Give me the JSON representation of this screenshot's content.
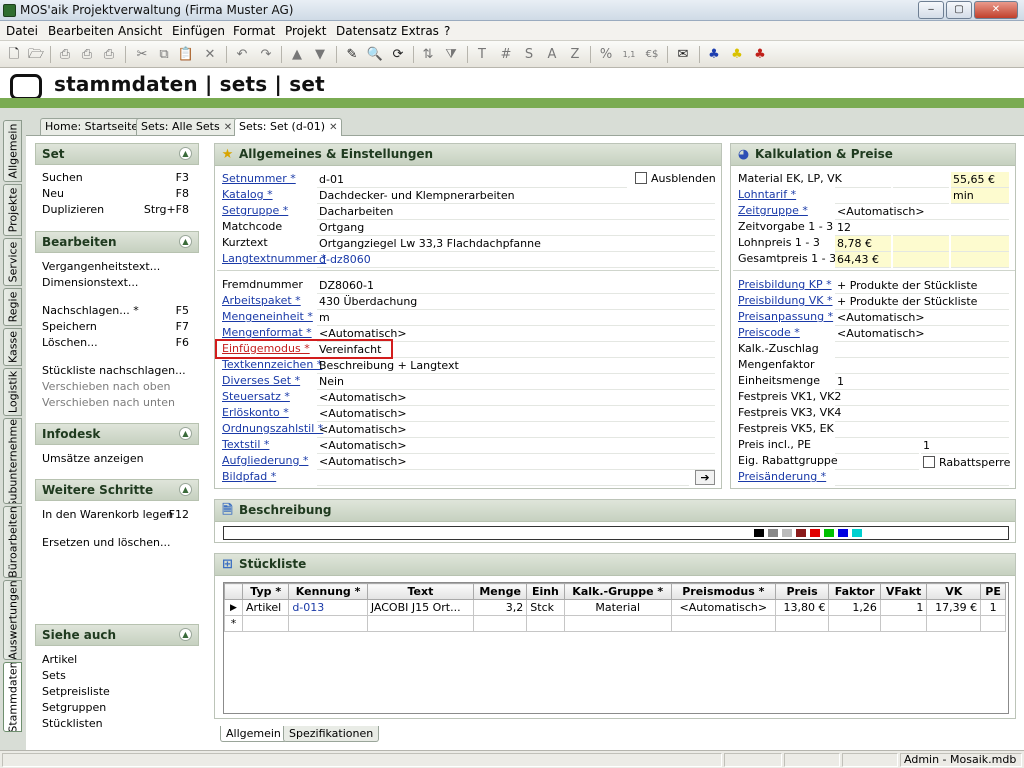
{
  "window": {
    "title": "MOS'aik Projektverwaltung (Firma Muster AG)",
    "min": "‒",
    "max": "▢",
    "close": "✕"
  },
  "menu": [
    "Datei",
    "Bearbeiten",
    "Ansicht",
    "Einfügen",
    "Format",
    "Projekt",
    "Datensatz",
    "Extras",
    "?"
  ],
  "toolbar_text": {
    "t": "T",
    "hash": "#",
    "s": "S",
    "a": "A",
    "z": "Z",
    "pct": "%",
    "num": "1,1",
    "eur": "€$"
  },
  "header": {
    "title": "stammdaten | sets | set"
  },
  "vtabs": [
    "Allgemein",
    "Projekte",
    "Service",
    "Regie",
    "Kasse",
    "Logistik",
    "Subunternehmer",
    "Büroarbeiten",
    "Auswertungen",
    "Stammdaten"
  ],
  "doctabs": [
    {
      "label": "Home: Startseite"
    },
    {
      "label": "Sets: Alle Sets",
      "close": "✕"
    },
    {
      "label": "Sets: Set (d-01)",
      "close": "✕"
    }
  ],
  "left": {
    "set": {
      "title": "Set",
      "items": [
        {
          "label": "Suchen",
          "key": "F3"
        },
        {
          "label": "Neu",
          "key": "F8"
        },
        {
          "label": "Duplizieren",
          "key": "Strg+F8"
        }
      ]
    },
    "bearbeiten": {
      "title": "Bearbeiten",
      "items": [
        {
          "label": "Vergangenheitstext..."
        },
        {
          "label": "Dimensionstext..."
        },
        {
          "label": "Nachschlagen... *",
          "key": "F5"
        },
        {
          "label": "Speichern",
          "key": "F7"
        },
        {
          "label": "Löschen...",
          "key": "F6"
        },
        {
          "label": "Stückliste nachschlagen..."
        },
        {
          "label": "Verschieben nach oben"
        },
        {
          "label": "Verschieben nach unten"
        }
      ]
    },
    "infodesk": {
      "title": "Infodesk",
      "items": [
        {
          "label": "Umsätze anzeigen"
        }
      ]
    },
    "weitere": {
      "title": "Weitere Schritte",
      "items": [
        {
          "label": "In den Warenkorb legen",
          "key": "F12"
        },
        {
          "label": "Ersetzen und löschen..."
        }
      ]
    },
    "siehe": {
      "title": "Siehe auch",
      "items": [
        {
          "label": "Artikel"
        },
        {
          "label": "Sets"
        },
        {
          "label": "Setpreisliste"
        },
        {
          "label": "Setgruppen"
        },
        {
          "label": "Stücklisten"
        }
      ]
    }
  },
  "allgemeines": {
    "title": "Allgemeines & Einstellungen",
    "ausblenden": "Ausblenden",
    "rows1": [
      {
        "label": "Setnummer *",
        "value": "d-01",
        "link": true
      },
      {
        "label": "Katalog *",
        "value": "Dachdecker- und Klempnerarbeiten",
        "link": true
      },
      {
        "label": "Setgruppe *",
        "value": "Dacharbeiten",
        "link": true
      },
      {
        "label": "Matchcode",
        "value": "Ortgang",
        "link": false
      },
      {
        "label": "Kurztext",
        "value": "Ortgangziegel Lw 33,3 Flachdachpfanne",
        "link": false
      },
      {
        "label": "Langtextnummer *",
        "value": "d-dz8060",
        "link": true,
        "bluevalue": true
      }
    ],
    "rows2": [
      {
        "label": "Fremdnummer",
        "value": "DZ8060-1",
        "link": false
      },
      {
        "label": "Arbeitspaket *",
        "value": "430 Überdachung",
        "link": true
      },
      {
        "label": "Mengeneinheit *",
        "value": "m",
        "link": true
      },
      {
        "label": "Mengenformat *",
        "value": "<Automatisch>",
        "link": true
      },
      {
        "label": "Einfügemodus *",
        "value": "Vereinfacht",
        "link": true,
        "highlight": true
      },
      {
        "label": "Textkennzeichen *",
        "value": "Beschreibung + Langtext",
        "link": true
      },
      {
        "label": "Diverses Set *",
        "value": "Nein",
        "link": true
      },
      {
        "label": "Steuersatz *",
        "value": "<Automatisch>",
        "link": true
      },
      {
        "label": "Erlöskonto *",
        "value": "<Automatisch>",
        "link": true
      },
      {
        "label": "Ordnungszahlstil *",
        "value": "<Automatisch>",
        "link": true
      },
      {
        "label": "Textstil *",
        "value": "<Automatisch>",
        "link": true
      },
      {
        "label": "Aufgliederung *",
        "value": "<Automatisch>",
        "link": true
      },
      {
        "label": "Bildpfad *",
        "value": "",
        "link": true
      }
    ]
  },
  "kalkulation": {
    "title": "Kalkulation & Preise",
    "rows1": [
      {
        "label": "Material EK, LP, VK",
        "v1": "",
        "v2": "",
        "v3": "55,65 €",
        "link": false
      },
      {
        "label": "Lohntarif *",
        "v1": "",
        "v2": "",
        "v3": "min",
        "link": true
      },
      {
        "label": "Zeitgruppe *",
        "v1": "<Automatisch>",
        "link": true,
        "wide": true
      },
      {
        "label": "Zeitvorgabe 1 - 3",
        "v1": "12",
        "v2": "",
        "v3": "",
        "link": false
      },
      {
        "label": "Lohnpreis 1 - 3",
        "v1": "8,78 €",
        "v2": "",
        "v3": "",
        "link": false,
        "yellowall": true
      },
      {
        "label": "Gesamtpreis 1 - 3",
        "v1": "64,43 €",
        "v2": "",
        "v3": "",
        "link": false,
        "yellowall": true
      }
    ],
    "rows2": [
      {
        "label": "Preisbildung KP *",
        "value": "+ Produkte der Stückliste",
        "link": true
      },
      {
        "label": "Preisbildung VK *",
        "value": "+ Produkte der Stückliste",
        "link": true
      },
      {
        "label": "Preisanpassung *",
        "value": "<Automatisch>",
        "link": true
      },
      {
        "label": "Preiscode *",
        "value": "<Automatisch>",
        "link": true
      },
      {
        "label": "Kalk.-Zuschlag",
        "value": "",
        "link": false
      },
      {
        "label": "Mengenfaktor",
        "value": "",
        "link": false
      },
      {
        "label": "Einheitsmenge",
        "value": "1",
        "link": false
      },
      {
        "label": "Festpreis VK1, VK2",
        "value": "",
        "link": false
      },
      {
        "label": "Festpreis VK3, VK4",
        "value": "",
        "link": false
      },
      {
        "label": "Festpreis VK5, EK",
        "value": "",
        "link": false
      },
      {
        "label": "Preis incl., PE",
        "value": "",
        "value2": "1",
        "link": false
      },
      {
        "label": "Eig. Rabattgruppe",
        "value": "",
        "link": false
      },
      {
        "label": "Preisänderung *",
        "value": "",
        "link": true
      }
    ],
    "rabattsperre": "Rabattsperre"
  },
  "beschreibung": {
    "title": "Beschreibung"
  },
  "stueckliste": {
    "title": "Stückliste",
    "columns": [
      "",
      "Typ *",
      "Kennung *",
      "Text",
      "Menge",
      "Einh",
      "Kalk.-Gruppe *",
      "Preismodus *",
      "Preis",
      "Faktor",
      "VFakt",
      "VK",
      "PE"
    ],
    "rows": [
      {
        "marker": "▶",
        "typ": "Artikel",
        "kennung": "d-013",
        "text": "JACOBI J15 Ort...",
        "menge": "3,2",
        "einh": "Stck",
        "kalk": "Material",
        "preismodus": "<Automatisch>",
        "preis": "13,80 €",
        "faktor": "1,26",
        "vfakt": "1",
        "vk": "17,39 €",
        "pe": "1"
      }
    ],
    "newrow_marker": "*"
  },
  "bottomtabs": [
    "Allgemein",
    "Spezifikationen"
  ],
  "status": {
    "user": "Admin - Mosaik.mdb"
  }
}
